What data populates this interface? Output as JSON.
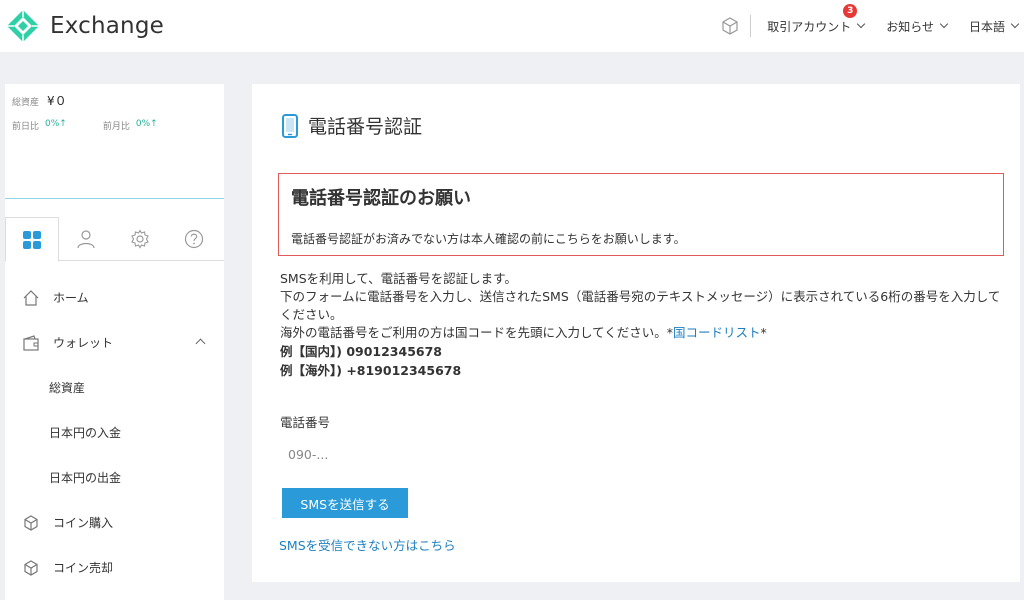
{
  "header": {
    "app_name": "Exchange",
    "account_label": "取引アカウント",
    "account_badge": "3",
    "news_label": "お知らせ",
    "language_label": "日本語"
  },
  "sidebar": {
    "balance_label": "総資産",
    "balance_value": "¥０",
    "prev_day_label": "前日比",
    "prev_day_value": "0%↑",
    "prev_month_label": "前月比",
    "prev_month_value": "0%↑",
    "menu": {
      "home": "ホーム",
      "wallet": "ウォレット",
      "total_assets": "総資産",
      "jpy_deposit": "日本円の入金",
      "jpy_withdraw": "日本円の出金",
      "coin_buy": "コイン購入",
      "coin_sell": "コイン売却"
    }
  },
  "main": {
    "title": "電話番号認証",
    "notice_heading": "電話番号認証のお願い",
    "notice_text": "電話番号認証がお済みでない方は本人確認の前にこちらをお願いします。",
    "desc_line1": "SMSを利用して、電話番号を認証します。",
    "desc_line2": "下のフォームに電話番号を入力し、送信されたSMS（電話番号宛のテキストメッセージ）に表示されている6桁の番号を入力してください。",
    "desc_line3_pre": "海外の電話番号をご利用の方は国コードを先頭に入力してください。*",
    "country_code_link": "国コードリスト",
    "desc_line3_post": "*",
    "example_domestic": "例【国内】) 09012345678",
    "example_overseas": "例【海外】) +819012345678",
    "phone_label": "電話番号",
    "phone_placeholder": "090-...",
    "phone_value": "",
    "send_button": "SMSを送信する",
    "help_link": "SMSを受信できない方はこちら"
  },
  "colors": {
    "accent": "#2a9ad9",
    "logo": "#2fd0a8",
    "notice_border": "#e05a5a",
    "positive": "#26b09a",
    "badge": "#e53935"
  }
}
